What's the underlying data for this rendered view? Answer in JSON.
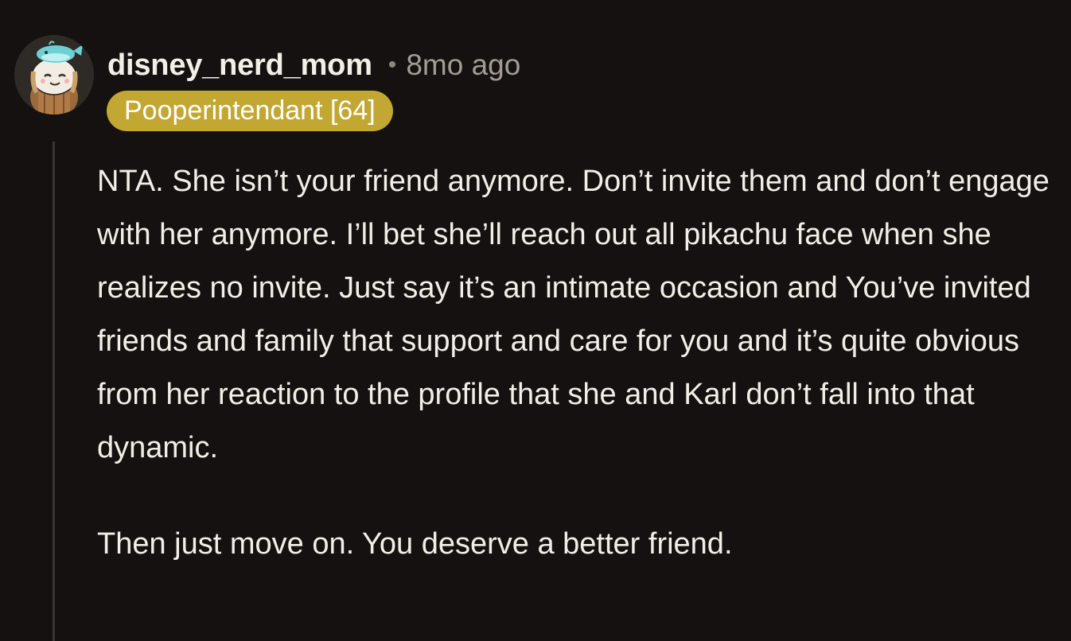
{
  "comment": {
    "avatar_icon": "snoo-avatar-with-whale-hat-icon",
    "username": "disney_nerd_mom",
    "separator": "•",
    "timestamp": "8mo ago",
    "flair": {
      "text": "Pooperintendant [64]",
      "background_color": "#c2a733",
      "text_color": "#ffffff"
    },
    "paragraphs": [
      "NTA. She isn’t your friend anymore. Don’t invite them and don’t engage with her anymore. I’ll bet she’ll reach out all pikachu face when she realizes no invite. Just say it’s an intimate occasion and You’ve invited friends and family that support and care for you and it’s quite obvious from her reaction to the profile that she and Karl don’t fall into that dynamic.",
      "Then just move on. You deserve a better friend."
    ]
  },
  "theme": {
    "background": "#141110",
    "text_primary": "#f2efe9",
    "text_secondary": "#a29c95",
    "thread_line": "#3a3633"
  }
}
